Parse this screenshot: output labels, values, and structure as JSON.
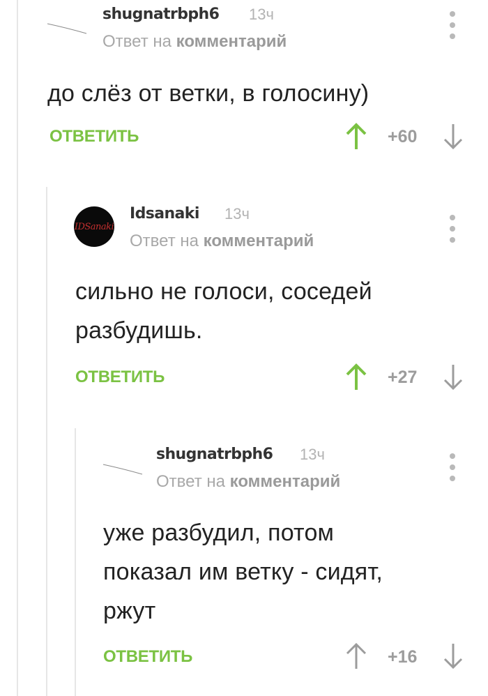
{
  "comments": [
    {
      "username": "shugnatrbph6",
      "time": "13ч",
      "reply_prefix": "Ответ на",
      "reply_link": "комментарий",
      "text": "до слёз от ветки, в голосину)",
      "reply_label": "ОТВЕТИТЬ",
      "score": "+60",
      "upvoted": true,
      "avatar": "blank-avatar"
    },
    {
      "username": "Idsanaki",
      "time": "13ч",
      "reply_prefix": "Ответ на",
      "reply_link": "комментарий",
      "text": "сильно не голоси, соседей\nразбудишь.",
      "reply_label": "ОТВЕТИТЬ",
      "score": "+27",
      "upvoted": true,
      "avatar": "round-avatar",
      "avatar_text": "IDSanaki"
    },
    {
      "username": "shugnatrbph6",
      "time": "13ч",
      "reply_prefix": "Ответ на",
      "reply_link": "комментарий",
      "text": "уже разбудил, потом\nпоказал им ветку - сидят,\nржут",
      "reply_label": "ОТВЕТИТЬ",
      "score": "+16",
      "upvoted": false,
      "avatar": "blank-avatar"
    }
  ],
  "colors": {
    "accent_green": "#7bc243",
    "arrow_grey": "#9c9c9c",
    "thread_line": "#e6e6e6"
  }
}
